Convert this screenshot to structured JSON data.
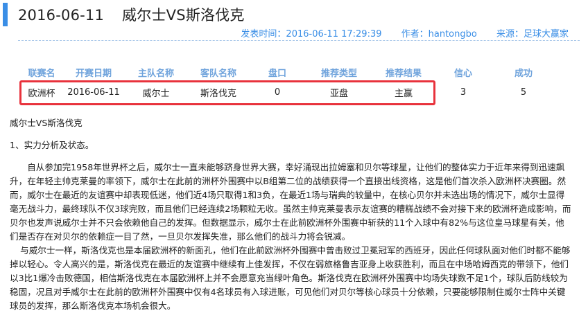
{
  "header": {
    "date": "2016-06-11",
    "title": "威尔士VS斯洛伐克",
    "publish_time": "发表时间：2016-06-11 17:29:39",
    "author": "作者：hantongbo",
    "source": "来源：足球大赢家",
    "accent_color": "#3a8ee6"
  },
  "table": {
    "columns": [
      "联赛名",
      "开赛日期",
      "主队名称",
      "客队名称",
      "盘口",
      "推荐类型",
      "推荐结果",
      "信心",
      "成功"
    ],
    "row": [
      "欧洲杯",
      "2016-06-11",
      "威尔士",
      "斯洛伐克",
      "0",
      "亚盘",
      "主赢",
      "3",
      "5"
    ],
    "highlight_color": "#e8323c"
  },
  "article": {
    "subtitle": "威尔士VS斯洛伐克",
    "section1": "1、实力分析及状态。",
    "para1": "自从参加完1958年世界杯之后，威尔士一直未能够跻身世界大赛，幸好涌现出拉姆塞和贝尔等球星，让他们的整体实力于近年来得到迅速飙升，在年轻主帅克莱曼的率领下，威尔士在此前的洲杯外围赛中以B组第二位的战绩获得一个直接出线资格，这是他们首次杀入欧洲杯决赛圈。然而，威尔士在最近的友谊赛中却表现低迷，他们近4场只取得1和3负，在最近1场与瑞典的较量中，在核心贝尔并未选出场的情况下，威尔士显得毫无战斗力，最终球队不仅3球完败，而且他们已经连续2场颗粒无收。虽然主帅克莱曼表示友谊赛的糟糕战绩不会对接下来的欧洲杯造成影响，而贝尔也发声说威尔士并不只会依赖他自己的发挥。但数据显示，威尔士在此前欧洲杯外围赛中斩获的11个入球中有82%与这位皇马球星有关，他们是否存在对贝尔的依赖症一目了然，一旦贝尔发挥失准，那么他们的战斗力将会锐减。",
    "para2": "与威尔士一样，斯洛伐克也是本届欧洲杯的新面孔，他们在此前欧洲杯外围赛中曾击败过卫冕冠军的西班牙，因此任何球队面对他们时都不能够掉以轻心。令人高兴的是，斯洛伐克在最近的友谊赛中继续有上佳发挥，不仅在弱旅格鲁吉亚身上收获胜利，而且在中场哈姆西克的带领下，他们以3比1爆冷击败德国，相信斯洛伐克在本届欧洲杯上并不会愿意充当绿叶角色。斯洛伐克在欧洲杯外围赛中均场失球数不足1个，球队后防线较为稳固，况且对手威尔士在此前的欧洲杯外围赛中仅有4名球员有入球进账，可见他们对贝尔等核心球员十分依赖，只要能够限制住威尔士阵中关键球员的发挥，那么斯洛伐克本场机会很大。"
  }
}
